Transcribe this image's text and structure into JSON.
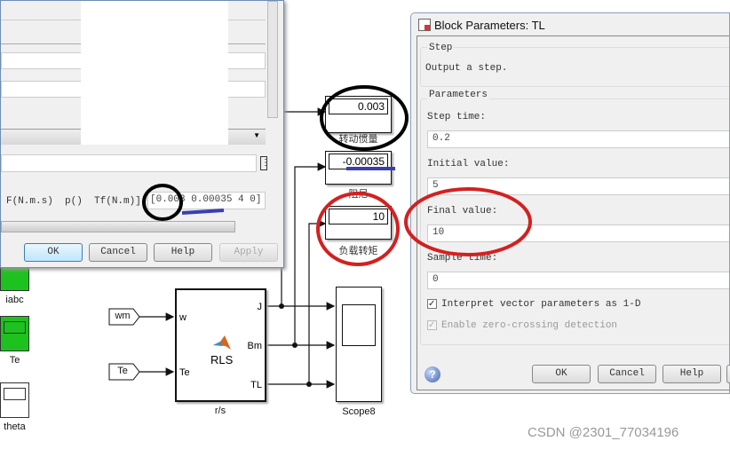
{
  "left_dialog": {
    "param_label": "F(N.m.s)  p()  Tf(N.m)]:",
    "param_value": "[0.003 0.00035 4 0]",
    "buttons": {
      "ok": "OK",
      "cancel": "Cancel",
      "help": "Help",
      "apply": "Apply"
    }
  },
  "displays": [
    {
      "value": "0.003",
      "label": "转动惯量"
    },
    {
      "value": "-0.00035",
      "label": "阻尼"
    },
    {
      "value": "10",
      "label": "负载转矩"
    }
  ],
  "right_dialog": {
    "title": "Block Parameters: TL",
    "group_step": "Step",
    "description": "Output a step.",
    "group_params": "Parameters",
    "step_time_label": "Step time:",
    "step_time": "0.2",
    "initial_label": "Initial value:",
    "initial": "5",
    "final_label": "Final value:",
    "final": "10",
    "sample_label": "Sample time:",
    "sample": "0",
    "interpret_label": "Interpret vector parameters as 1-D",
    "zero_cross_label": "Enable zero-crossing detection",
    "buttons": {
      "ok": "OK",
      "cancel": "Cancel",
      "help": "Help"
    }
  },
  "model": {
    "tag_wm": "wm",
    "tag_te": "Te",
    "rls_block": {
      "name": "r/s",
      "text": "RLS",
      "inputs": [
        "w",
        "Te"
      ],
      "outputs": [
        "J",
        "Bm",
        "TL"
      ]
    },
    "scope_label": "Scope8",
    "left_blocks": [
      "iabc",
      "Te",
      "theta"
    ]
  },
  "annotations": {
    "circle_black": "#000000",
    "circle_red": "#d42020",
    "underline_blue": "#3a3fb0"
  },
  "watermark": "CSDN @2301_77034196"
}
